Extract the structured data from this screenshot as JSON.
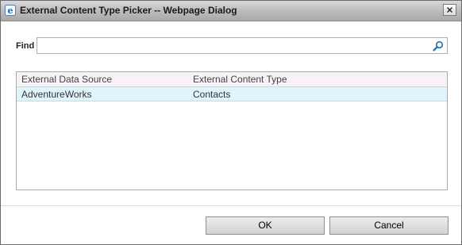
{
  "window": {
    "title": "External Content Type Picker -- Webpage Dialog",
    "close_glyph": "×"
  },
  "find": {
    "label": "Find",
    "value": "",
    "placeholder": "",
    "icon": "search-icon"
  },
  "grid": {
    "columns": [
      "External Data Source",
      "External Content Type"
    ],
    "rows": [
      {
        "source": "AdventureWorks",
        "type": "Contacts",
        "selected": true
      }
    ],
    "selected_row_color": "#dff4fb",
    "header_color": "#f8f1f5"
  },
  "buttons": {
    "ok": "OK",
    "cancel": "Cancel"
  },
  "colors": {
    "titlebar": "#bfbfbf",
    "search_icon": "#1d6fb8",
    "app_icon": "#1e66c8"
  }
}
